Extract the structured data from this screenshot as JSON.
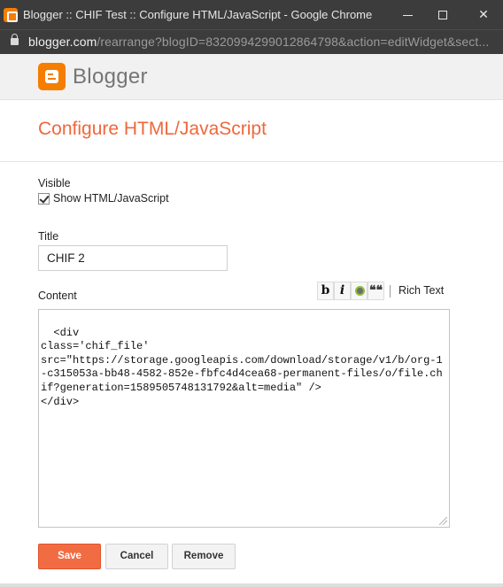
{
  "window": {
    "title": "Blogger :: CHIF Test :: Configure HTML/JavaScript - Google Chrome",
    "icon": "blogger-icon"
  },
  "address_bar": {
    "host": "blogger.com",
    "path": "/rearrange?blogID=8320994299012864798&action=editWidget&sect..."
  },
  "header": {
    "brand": "Blogger",
    "logo": "blogger-logo-icon"
  },
  "page": {
    "title": "Configure HTML/JavaScript"
  },
  "form": {
    "visible_label": "Visible",
    "show_checkbox_label": "Show HTML/JavaScript",
    "show_checked": true,
    "title_label": "Title",
    "title_value": "CHIF 2",
    "content_label": "Content",
    "rich_text_label": "Rich Text",
    "toolbar": {
      "bold_glyph": "b",
      "italic_glyph": "i",
      "quote_glyph": "❝❝"
    },
    "content_value": "<div\nclass='chif_file'\nsrc=\"https://storage.googleapis.com/download/storage/v1/b/org-1-c315053a-bb48-4582-852e-fbfc4d4cea68-permanent-files/o/file.chif?generation=1589505748131792&alt=media\" />\n</div>"
  },
  "buttons": {
    "save": "Save",
    "cancel": "Cancel",
    "remove": "Remove"
  },
  "colors": {
    "accent": "#f26c43",
    "title_color": "#f0673b",
    "chrome_bar": "#3c3c3c"
  }
}
